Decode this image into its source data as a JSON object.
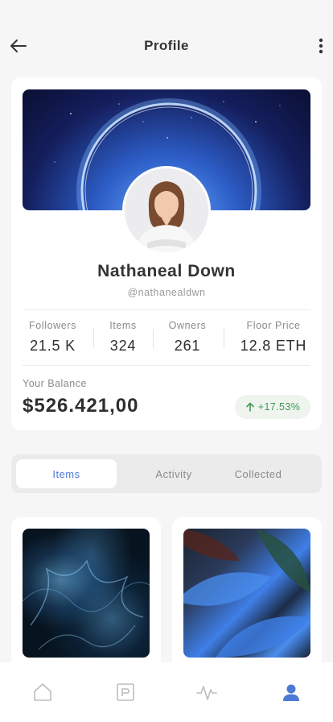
{
  "header": {
    "title": "Profile"
  },
  "profile": {
    "name": "Nathaneal Down",
    "handle": "@nathanealdwn"
  },
  "stats": [
    {
      "label": "Followers",
      "value": "21.5 K"
    },
    {
      "label": "Items",
      "value": "324"
    },
    {
      "label": "Owners",
      "value": "261"
    },
    {
      "label": "Floor Price",
      "value": "12.8 ETH"
    }
  ],
  "balance": {
    "label": "Your Balance",
    "value": "$526.421,00",
    "change": "+17.53%",
    "change_color": "#3d9c52"
  },
  "tabs": [
    {
      "label": "Items",
      "active": true
    },
    {
      "label": "Activity",
      "active": false
    },
    {
      "label": "Collected",
      "active": false
    }
  ],
  "items": [
    {
      "image": "blue-smoke-artwork"
    },
    {
      "image": "blue-leaves-artwork"
    }
  ],
  "bottom_nav": [
    {
      "icon": "home-icon",
      "active": false
    },
    {
      "icon": "wallet-icon",
      "active": false
    },
    {
      "icon": "activity-icon",
      "active": false
    },
    {
      "icon": "profile-icon",
      "active": true
    }
  ],
  "colors": {
    "accent": "#4d7ad6",
    "background": "#f6f6f6",
    "positive": "#3d9c52"
  }
}
